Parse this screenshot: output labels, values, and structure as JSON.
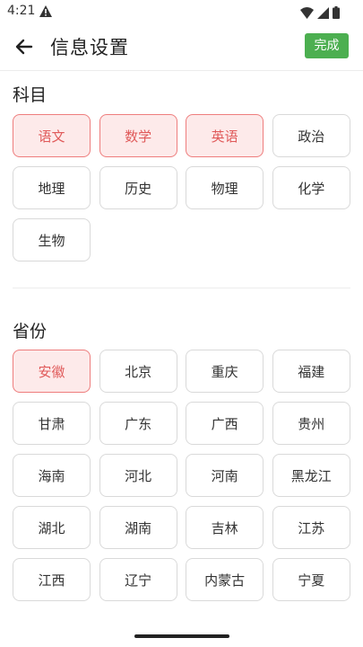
{
  "status_bar": {
    "time": "4:21"
  },
  "header": {
    "title": "信息设置",
    "done_label": "完成"
  },
  "subjects": {
    "title": "科目",
    "items": [
      {
        "label": "语文",
        "selected": true
      },
      {
        "label": "数学",
        "selected": true
      },
      {
        "label": "英语",
        "selected": true
      },
      {
        "label": "政治",
        "selected": false
      },
      {
        "label": "地理",
        "selected": false
      },
      {
        "label": "历史",
        "selected": false
      },
      {
        "label": "物理",
        "selected": false
      },
      {
        "label": "化学",
        "selected": false
      },
      {
        "label": "生物",
        "selected": false
      }
    ]
  },
  "provinces": {
    "title": "省份",
    "items": [
      {
        "label": "安徽",
        "selected": true
      },
      {
        "label": "北京",
        "selected": false
      },
      {
        "label": "重庆",
        "selected": false
      },
      {
        "label": "福建",
        "selected": false
      },
      {
        "label": "甘肃",
        "selected": false
      },
      {
        "label": "广东",
        "selected": false
      },
      {
        "label": "广西",
        "selected": false
      },
      {
        "label": "贵州",
        "selected": false
      },
      {
        "label": "海南",
        "selected": false
      },
      {
        "label": "河北",
        "selected": false
      },
      {
        "label": "河南",
        "selected": false
      },
      {
        "label": "黑龙江",
        "selected": false
      },
      {
        "label": "湖北",
        "selected": false
      },
      {
        "label": "湖南",
        "selected": false
      },
      {
        "label": "吉林",
        "selected": false
      },
      {
        "label": "江苏",
        "selected": false
      },
      {
        "label": "江西",
        "selected": false
      },
      {
        "label": "辽宁",
        "selected": false
      },
      {
        "label": "内蒙古",
        "selected": false
      },
      {
        "label": "宁夏",
        "selected": false
      }
    ]
  },
  "colors": {
    "accent_green": "#4caf50",
    "selected_text": "#e05a5a",
    "selected_bg": "#fdeaea",
    "selected_border": "#ee7d7d",
    "chip_border": "#d9d9d9"
  },
  "icons": {
    "back": "arrow-left-icon",
    "warning": "warning-icon",
    "wifi": "wifi-icon",
    "signal": "cell-signal-icon",
    "battery": "battery-icon"
  }
}
